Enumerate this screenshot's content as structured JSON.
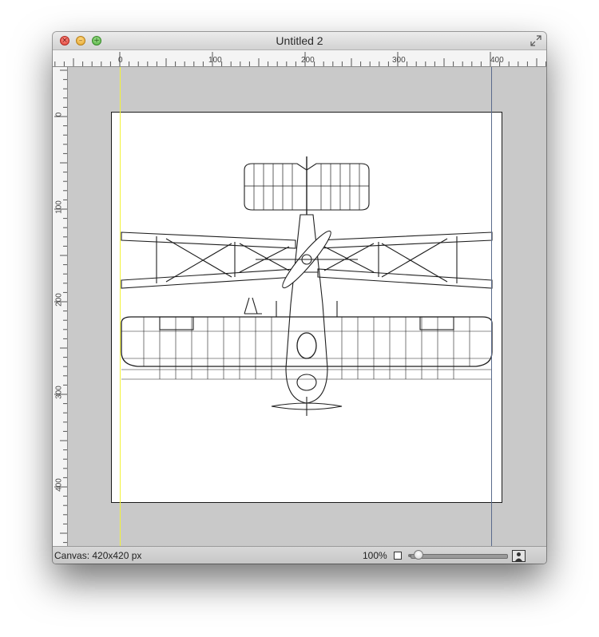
{
  "window": {
    "title": "Untitled 2"
  },
  "ruler": {
    "horizontal_labels": [
      "0",
      "100",
      "200",
      "300",
      "400"
    ],
    "vertical_labels": [
      "0",
      "100",
      "200",
      "300",
      "400"
    ]
  },
  "status": {
    "canvas_info": "Canvas: 420x420 px",
    "zoom": "100%",
    "zoom_level": 0.08
  },
  "colors": {
    "guide_left": "#f2f23a",
    "guide_right": "#5a6b8c",
    "workspace": "#c9c9c9"
  },
  "icons": [
    "close-icon",
    "minimize-icon",
    "zoom-icon",
    "fullscreen-icon",
    "fit-screen-icon",
    "actual-size-icon"
  ],
  "image": {
    "subject": "biplane-line-drawing"
  }
}
